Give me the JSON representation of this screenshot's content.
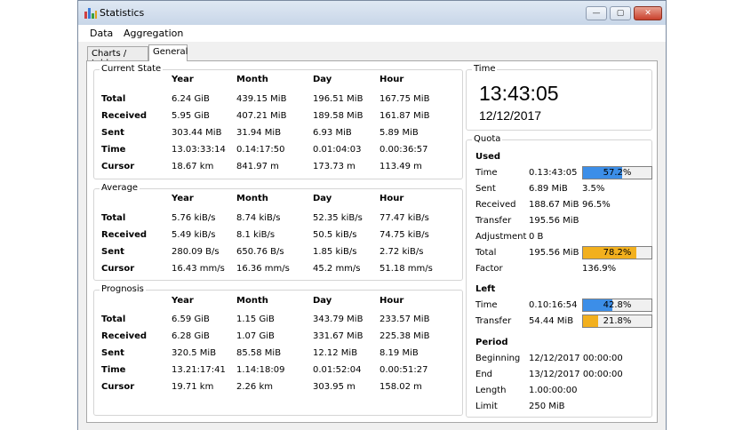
{
  "window": {
    "title": "Statistics",
    "buttons": {
      "minimize": "—",
      "maximize": "▢",
      "close": "✕"
    }
  },
  "menu": [
    "Data",
    "Aggregation"
  ],
  "tabs": [
    {
      "label": "Charts / tables",
      "active": false
    },
    {
      "label": "General",
      "active": true
    }
  ],
  "current_state": {
    "title": "Current State",
    "columns": [
      "Year",
      "Month",
      "Day",
      "Hour"
    ],
    "rows": [
      {
        "label": "Total",
        "values": [
          "6.24 GiB",
          "439.15 MiB",
          "196.51 MiB",
          "167.75 MiB"
        ]
      },
      {
        "label": "Received",
        "values": [
          "5.95 GiB",
          "407.21 MiB",
          "189.58 MiB",
          "161.87 MiB"
        ]
      },
      {
        "label": "Sent",
        "values": [
          "303.44 MiB",
          "31.94 MiB",
          "6.93 MiB",
          "5.89 MiB"
        ]
      },
      {
        "label": "Time",
        "values": [
          "13.03:33:14",
          "0.14:17:50",
          "0.01:04:03",
          "0.00:36:57"
        ]
      },
      {
        "label": "Cursor",
        "values": [
          "18.67 km",
          "841.97 m",
          "173.73 m",
          "113.49 m"
        ]
      }
    ]
  },
  "average": {
    "title": "Average",
    "columns": [
      "Year",
      "Month",
      "Day",
      "Hour"
    ],
    "rows": [
      {
        "label": "Total",
        "values": [
          "5.76 kiB/s",
          "8.74 kiB/s",
          "52.35 kiB/s",
          "77.47 kiB/s"
        ]
      },
      {
        "label": "Received",
        "values": [
          "5.49 kiB/s",
          "8.1 kiB/s",
          "50.5 kiB/s",
          "74.75 kiB/s"
        ]
      },
      {
        "label": "Sent",
        "values": [
          "280.09 B/s",
          "650.76 B/s",
          "1.85 kiB/s",
          "2.72 kiB/s"
        ]
      },
      {
        "label": "Cursor",
        "values": [
          "16.43 mm/s",
          "16.36 mm/s",
          "45.2 mm/s",
          "51.18 mm/s"
        ]
      }
    ]
  },
  "prognosis": {
    "title": "Prognosis",
    "columns": [
      "Year",
      "Month",
      "Day",
      "Hour"
    ],
    "rows": [
      {
        "label": "Total",
        "values": [
          "6.59 GiB",
          "1.15 GiB",
          "343.79 MiB",
          "233.57 MiB"
        ]
      },
      {
        "label": "Received",
        "values": [
          "6.28 GiB",
          "1.07 GiB",
          "331.67 MiB",
          "225.38 MiB"
        ]
      },
      {
        "label": "Sent",
        "values": [
          "320.5 MiB",
          "85.58 MiB",
          "12.12 MiB",
          "8.19 MiB"
        ]
      },
      {
        "label": "Time",
        "values": [
          "13.21:17:41",
          "1.14:18:09",
          "0.01:52:04",
          "0.00:51:27"
        ]
      },
      {
        "label": "Cursor",
        "values": [
          "19.71 km",
          "2.26 km",
          "303.95 m",
          "158.02 m"
        ]
      }
    ]
  },
  "time_box": {
    "title": "Time",
    "clock": "13:43:05",
    "date": "12/12/2017"
  },
  "quota": {
    "title": "Quota",
    "used": {
      "heading": "Used",
      "time": {
        "label": "Time",
        "value": "0.13:43:05",
        "bar_text": "57.2%",
        "bar_fraction": 0.572,
        "bar_color": "#3c8ee8"
      },
      "sent": {
        "label": "Sent",
        "value": "6.89 MiB",
        "extra": "3.5%"
      },
      "received": {
        "label": "Received",
        "value": "188.67 MiB",
        "extra": "96.5%"
      },
      "transfer": {
        "label": "Transfer",
        "value": "195.56 MiB"
      },
      "adjustment": {
        "label": "Adjustment",
        "value": "0 B"
      },
      "total": {
        "label": "Total",
        "value": "195.56 MiB",
        "bar_text": "78.2%",
        "bar_fraction": 0.782,
        "bar_color": "#f2b01e"
      },
      "factor": {
        "label": "Factor",
        "extra": "136.9%"
      }
    },
    "left": {
      "heading": "Left",
      "time": {
        "label": "Time",
        "value": "0.10:16:54",
        "bar_text": "42.8%",
        "bar_fraction": 0.428,
        "bar_color": "#3c8ee8"
      },
      "transfer": {
        "label": "Transfer",
        "value": "54.44 MiB",
        "bar_text": "21.8%",
        "bar_fraction": 0.218,
        "bar_color": "#f2b01e"
      }
    },
    "period": {
      "heading": "Period",
      "beginning": {
        "label": "Beginning",
        "value": "12/12/2017 00:00:00"
      },
      "end": {
        "label": "End",
        "value": "13/12/2017 00:00:00"
      },
      "length": {
        "label": "Length",
        "value": "1.00:00:00"
      },
      "limit": {
        "label": "Limit",
        "value": "250 MiB"
      }
    }
  }
}
